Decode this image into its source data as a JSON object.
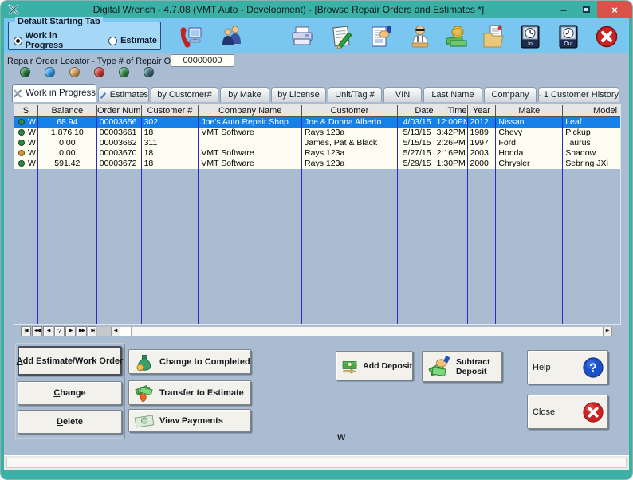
{
  "window": {
    "title": "Digital Wrench - 4.7.08 (VMT Auto - Development) - [Browse Repair Orders and Estimates *]",
    "icon": "crossed-tools",
    "controls": {
      "minimize": "–",
      "maximize": "maximize-box",
      "close": "×"
    }
  },
  "toolbar": {
    "group": {
      "label": "Default Starting Tab",
      "options": [
        {
          "label": "Work in Progress",
          "selected": true
        },
        {
          "label": "Estimate",
          "selected": false
        }
      ]
    },
    "icons": [
      {
        "name": "phone-computer"
      },
      {
        "name": "customers"
      },
      {
        "name": "printer"
      },
      {
        "name": "work-order-pad"
      },
      {
        "name": "invoice-hand"
      },
      {
        "name": "technician"
      },
      {
        "name": "money"
      },
      {
        "name": "folder-document"
      },
      {
        "name": "time-clock-in",
        "caption": "In"
      },
      {
        "name": "time-clock-out",
        "caption": "Out"
      },
      {
        "name": "exit"
      }
    ]
  },
  "locator": {
    "label": "Repair Order Locator - Type # of Repair Order:",
    "value": "00000000"
  },
  "status_dots": [
    {
      "name": "dark-green",
      "color": "#1f7a3a"
    },
    {
      "name": "blue",
      "color": "#2f9df2"
    },
    {
      "name": "orange",
      "color": "#dba45c"
    },
    {
      "name": "red",
      "color": "#d23a32"
    },
    {
      "name": "green",
      "color": "#2f8f4a"
    },
    {
      "name": "slate",
      "color": "#366a78"
    }
  ],
  "tabs": [
    {
      "label": "Work in Progress",
      "active": true,
      "icon": "crossed-tools"
    },
    {
      "label": "Estimates",
      "icon": "pencil"
    },
    {
      "label": "by Customer#"
    },
    {
      "label": "by Make"
    },
    {
      "label": "by License"
    },
    {
      "label": "Unit/Tag #"
    },
    {
      "label": "VIN"
    },
    {
      "label": "Last Name"
    },
    {
      "label": "Company"
    },
    {
      "label": "1 Customer History",
      "icon": "customers-small"
    }
  ],
  "table": {
    "columns": [
      "S",
      "Balance",
      "Order Num",
      "Customer #",
      "Company Name",
      "Customer",
      "Date",
      "Time",
      "Year",
      "Make",
      "Model"
    ],
    "rows": [
      {
        "status_color": "#2d8a46",
        "s": "W",
        "balance": "68.94",
        "order_num": "00003656",
        "customer_num": "302",
        "company": "Joe's Auto Repair Shop",
        "customer": "Joe & Donna Alberto",
        "date": "4/03/15",
        "time": "12:00PM",
        "year": "2012",
        "make": "Nissan",
        "model": "Leaf",
        "selected": true
      },
      {
        "status_color": "#2d8a46",
        "s": "W",
        "balance": "1,876.10",
        "order_num": "00003661",
        "customer_num": "18",
        "company": "VMT Software",
        "customer": "Rays 123a",
        "date": "5/13/15",
        "time": "3:42PM",
        "year": "1989",
        "make": "Chevy",
        "model": "Pickup",
        "selected": false
      },
      {
        "status_color": "#2d8a46",
        "s": "W",
        "balance": "0.00",
        "order_num": "00003662",
        "customer_num": "311",
        "company": "",
        "customer": "James, Pat & Black",
        "date": "5/15/15",
        "time": "2:26PM",
        "year": "1997",
        "make": "Ford",
        "model": "Taurus",
        "selected": false
      },
      {
        "status_color": "#d2973f",
        "s": "W",
        "balance": "0.00",
        "order_num": "00003670",
        "customer_num": "18",
        "company": "VMT Software",
        "customer": "Rays 123a",
        "date": "5/27/15",
        "time": "2:16PM",
        "year": "2003",
        "make": "Honda",
        "model": "Shadow",
        "selected": false
      },
      {
        "status_color": "#2d8a46",
        "s": "W",
        "balance": "591.42",
        "order_num": "00003672",
        "customer_num": "18",
        "company": "VMT Software",
        "customer": "Rays 123a",
        "date": "5/29/15",
        "time": "1:30PM",
        "year": "2000",
        "make": "Chrysler",
        "model": "Sebring JXi",
        "selected": false
      }
    ]
  },
  "nav": {
    "first": "|◀",
    "fast_back": "◀◀",
    "back": "◀",
    "help": "?",
    "forward": "▶",
    "fast_forward": "▶▶",
    "last": "▶|",
    "scroll_left": "◀",
    "scroll_right": "▶"
  },
  "actions": {
    "add_estimate": {
      "mnemonic": "A",
      "rest": "dd Estimate/Work Order"
    },
    "change": {
      "mnemonic": "C",
      "rest": "hange"
    },
    "delete": {
      "mnemonic": "D",
      "rest": "elete"
    },
    "change_completed": {
      "label": "Change to Completed",
      "icon": "money-bag"
    },
    "transfer_estimate": {
      "label": "Transfer to Estimate",
      "icon": "money-fire"
    },
    "view_payments": {
      "label": "View Payments",
      "icon": "dollar-bill"
    },
    "add_deposit": {
      "label": "Add Deposit",
      "icon": "money-stack-arrow"
    },
    "subtract_deposit": {
      "line1": "Subtract",
      "line2": "Deposit",
      "icon": "hand-taking-money"
    },
    "help": {
      "label": "Help",
      "icon": "question-circle"
    },
    "close": {
      "label": "Close",
      "icon": "red-x-circle"
    }
  },
  "footer": {
    "status_text": "W"
  },
  "colors": {
    "titlebar": "#3ab0a6",
    "toolbar": "#79c7f1",
    "background": "#a9bcd2",
    "row_selected": "#1580e8",
    "grid_line": "#2a2ac8",
    "row_bg": "#fdfdf2",
    "close_button": "#d9534a"
  }
}
